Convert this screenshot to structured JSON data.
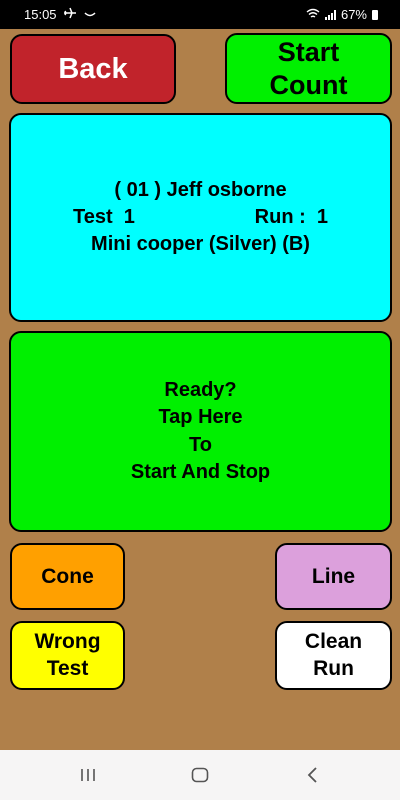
{
  "status_bar": {
    "time": "15:05",
    "battery": "67%",
    "icons": [
      "airplane-icon",
      "cloud-icon",
      "wifi-icon",
      "signal-icon",
      "battery-icon"
    ]
  },
  "buttons": {
    "back": "Back",
    "start_count": [
      "Start",
      "Count"
    ],
    "cone": "Cone",
    "line": "Line",
    "wrong_test": [
      "Wrong",
      "Test"
    ],
    "clean_run": [
      "Clean",
      "Run"
    ]
  },
  "info": {
    "driver": "( 01 ) Jeff osborne",
    "test_label": "Test  1",
    "run_label": "Run :  1",
    "car": "Mini cooper (Silver) (B)"
  },
  "timer_panel": {
    "lines": [
      "Ready?",
      "Tap Here",
      "To",
      "Start And Stop"
    ]
  },
  "nav": {
    "icons": [
      "recent-apps-icon",
      "home-icon",
      "back-icon"
    ]
  },
  "colors": {
    "background": "#b0804a",
    "back_button": "#c1232b",
    "start_button": "#00f000",
    "info_panel": "#00ffff",
    "timer_panel": "#00f000",
    "cone_button": "#ffa000",
    "line_button": "#dca0dc",
    "wrong_test_button": "#ffff00",
    "clean_run_button": "#ffffff"
  }
}
